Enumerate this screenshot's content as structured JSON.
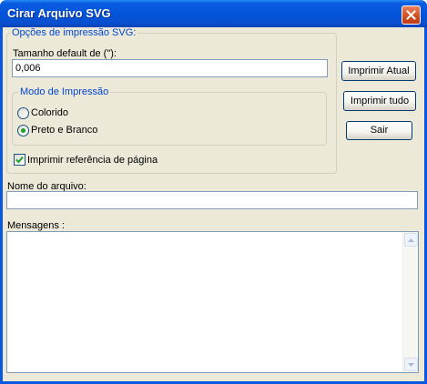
{
  "window": {
    "title": "Cirar Arquivo SVG"
  },
  "print_options": {
    "legend": "Opções de impressão SVG:",
    "default_size_label": "Tamanho default de  (\"):",
    "default_size_value": "0,006",
    "print_mode": {
      "legend": "Modo de Impressão",
      "options": [
        {
          "label": "Colorido",
          "selected": false
        },
        {
          "label": "Preto e Branco",
          "selected": true
        }
      ]
    },
    "page_reference": {
      "label": "Imprimir referência de página",
      "checked": true
    }
  },
  "buttons": {
    "print_current": "Imprimir Atual",
    "print_all": "Imprimir tudo",
    "exit": "Sair"
  },
  "file_name": {
    "label": "Nome do arquivo:",
    "value": ""
  },
  "messages": {
    "label": "Mensagens :",
    "value": ""
  },
  "colors": {
    "title_bar": "#0353d8",
    "dialog_bg": "#ece9d8",
    "group_legend": "#0046d5",
    "close_button": "#d24b20"
  }
}
